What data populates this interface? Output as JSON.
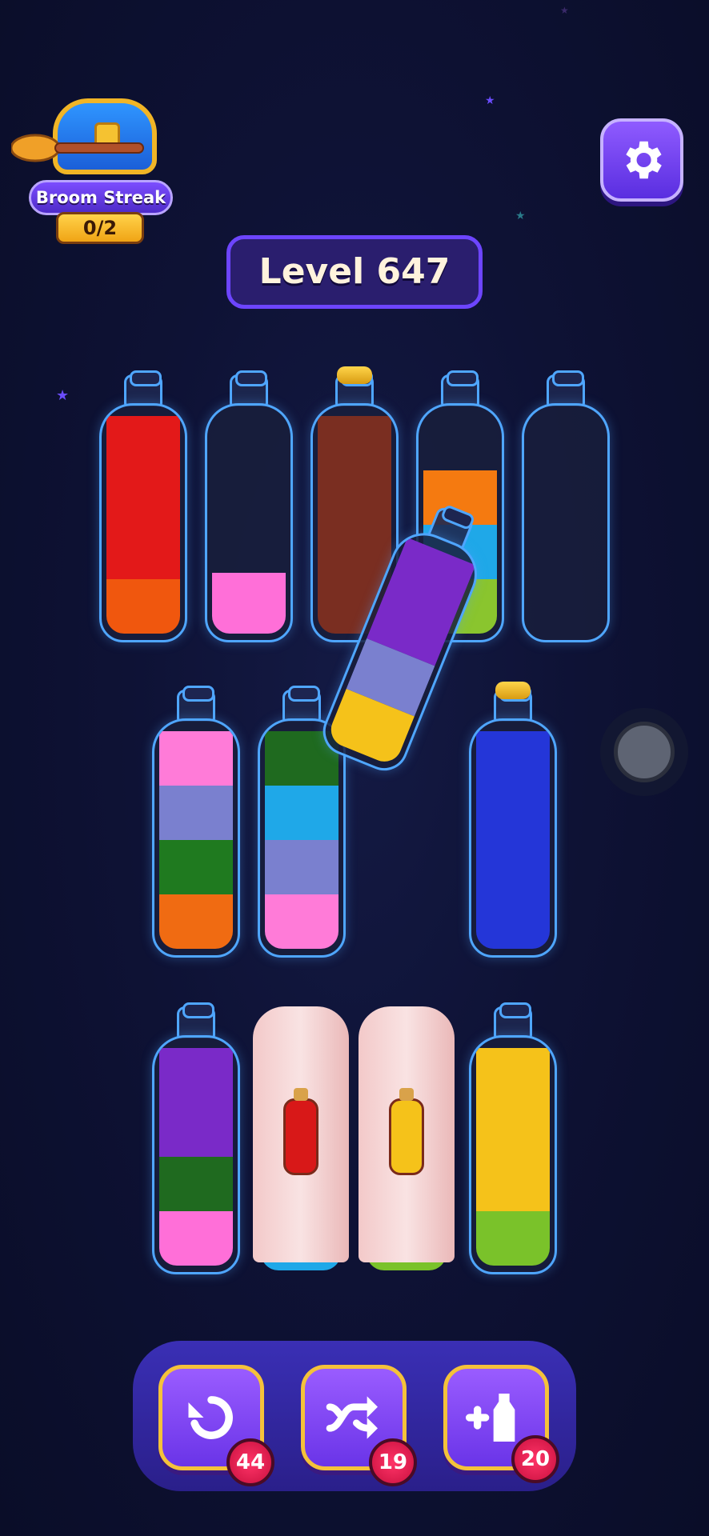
{
  "streak": {
    "label": "Broom Streak",
    "count": "0/2"
  },
  "level": {
    "label": "Level 647"
  },
  "settings": {
    "icon": "gear-icon"
  },
  "rows": [
    [
      {
        "colors": [
          "#f0570e",
          "#e31919"
        ],
        "fill": [
          0.25,
          0.75
        ]
      },
      {
        "colors": [
          "#ff6fd8"
        ],
        "fill": [
          0.28
        ]
      },
      {
        "colors": [
          "#7a2e21"
        ],
        "fill": [
          1.0
        ],
        "corked": true
      },
      {
        "colors": [
          "#8ac52e",
          "#1fa8e8",
          "#f57a10"
        ],
        "fill": [
          0.25,
          0.25,
          0.25
        ]
      },
      {
        "colors": [],
        "fill": []
      }
    ],
    [
      {
        "colors": [
          "#f06b12",
          "#1f7a1f",
          "#7a80cf",
          "#ff7bd8"
        ],
        "fill": [
          0.25,
          0.25,
          0.25,
          0.25
        ]
      },
      {
        "colors": [
          "#ff7bd8",
          "#7a80cf",
          "#1fa8e8",
          "#1f6a1f"
        ],
        "fill": [
          0.25,
          0.25,
          0.25,
          0.25
        ]
      },
      {
        "colors": [
          "#2436d8"
        ],
        "fill": [
          1.0
        ],
        "corked": true
      }
    ],
    [
      {
        "colors": [
          "#ff6fd8",
          "#1f6a1f",
          "#7a2ac8"
        ],
        "fill": [
          0.25,
          0.25,
          0.5
        ]
      },
      {
        "covered": true,
        "mini": "#d81818",
        "peek": "#1fa8e8"
      },
      {
        "covered": true,
        "mini": "#f5c21a",
        "peek": "#7ac22a"
      },
      {
        "colors": [
          "#7ac22a",
          "#f5c21a"
        ],
        "fill": [
          0.25,
          0.75
        ]
      }
    ]
  ],
  "tilted": {
    "colors": [
      "#f5c21a",
      "#7a80cf",
      "#7a2ac8"
    ],
    "fill": [
      0.25,
      0.25,
      0.5
    ]
  },
  "powerups": [
    {
      "name": "undo",
      "icon": "undo-icon",
      "count": "44"
    },
    {
      "name": "shuffle",
      "icon": "shuffle-icon",
      "count": "19"
    },
    {
      "name": "add-tube",
      "icon": "add-bottle-icon",
      "count": "20"
    }
  ]
}
